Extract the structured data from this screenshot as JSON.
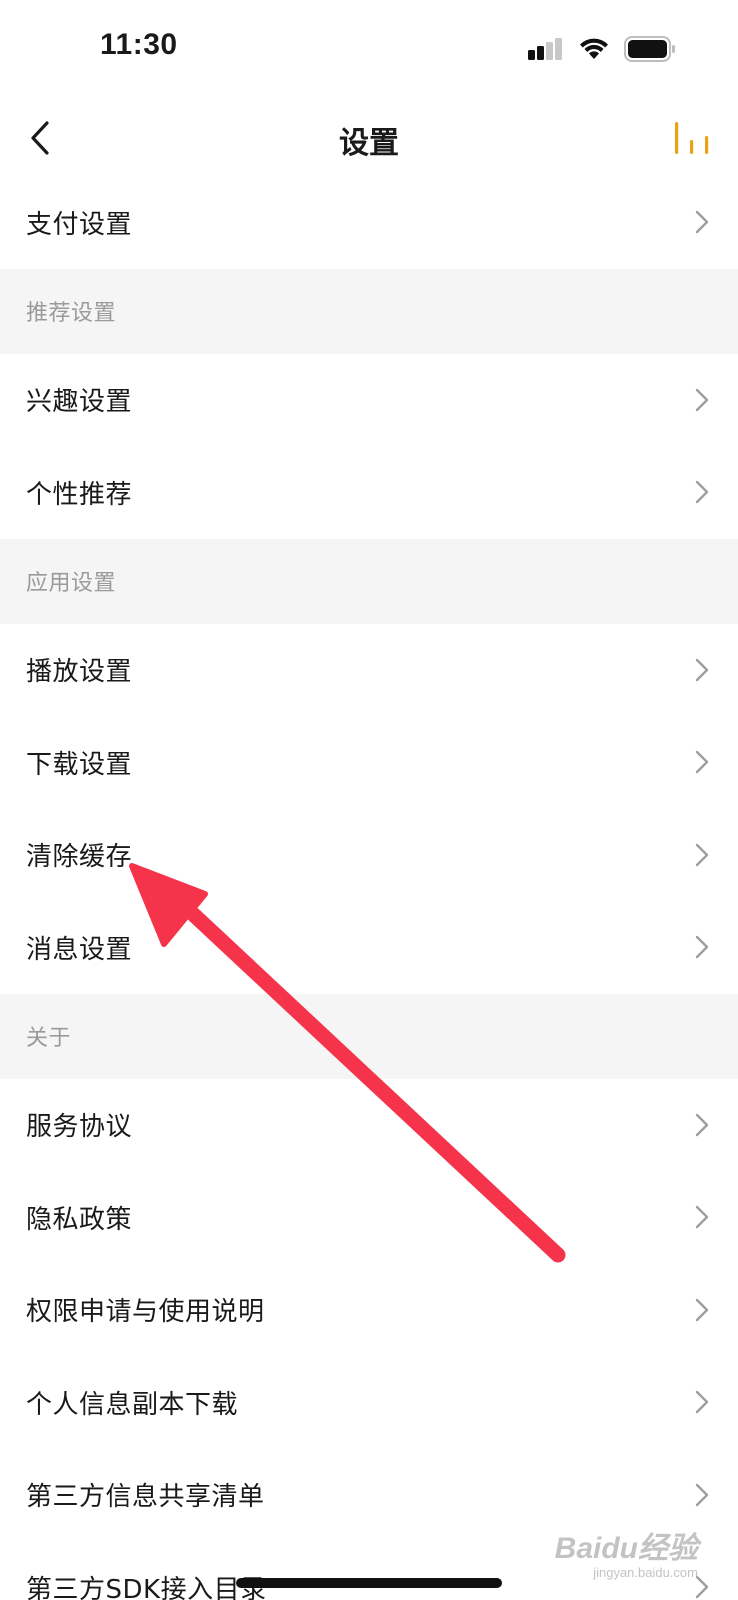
{
  "status_bar": {
    "time": "11:30"
  },
  "nav": {
    "title": "设置",
    "back_icon": "chevron-left-icon",
    "action_icon": "bar-chart-icon",
    "accent_color": "#e8a317"
  },
  "rows": {
    "payment": "支付设置",
    "interest": "兴趣设置",
    "personalized": "个性推荐",
    "playback": "播放设置",
    "download": "下载设置",
    "clear_cache": "清除缓存",
    "message": "消息设置",
    "service_agreement": "服务协议",
    "privacy": "隐私政策",
    "permissions": "权限申请与使用说明",
    "personal_info_download": "个人信息副本下载",
    "third_party_share": "第三方信息共享清单",
    "third_party_sdk": "第三方SDK接入目录"
  },
  "sections": {
    "recommend": "推荐设置",
    "app": "应用设置",
    "about": "关于"
  },
  "annotation": {
    "arrow_color": "#f5344b"
  },
  "watermark": {
    "main": "Baidu经验",
    "sub": "jingyan.baidu.com"
  }
}
